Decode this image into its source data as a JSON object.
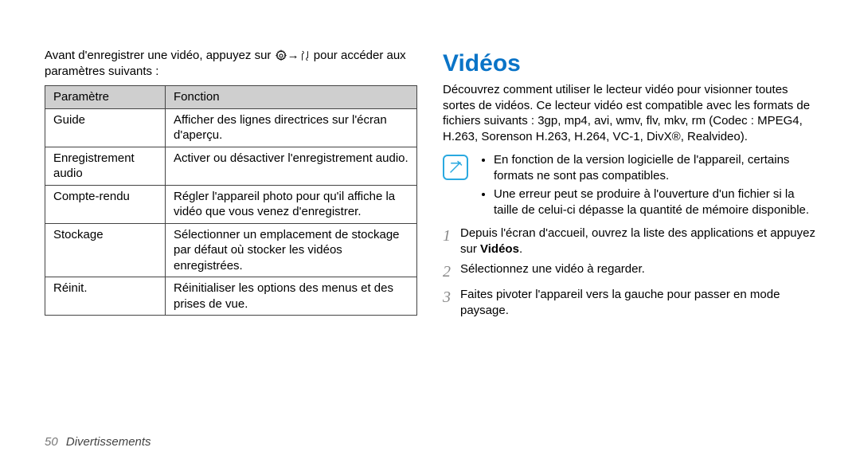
{
  "left": {
    "intro": "Avant d'enregistrer une vidéo, appuyez sur ",
    "intro_after_icons": " pour accéder aux paramètres suivants :",
    "table": {
      "head": {
        "param": "Paramètre",
        "func": "Fonction"
      },
      "rows": [
        {
          "param": "Guide",
          "func": "Afficher des lignes directrices sur l'écran d'aperçu."
        },
        {
          "param": "Enregistrement audio",
          "func": "Activer ou désactiver l'enregistrement audio."
        },
        {
          "param": "Compte-rendu",
          "func": "Régler l'appareil photo pour qu'il affiche la vidéo que vous venez d'enregistrer."
        },
        {
          "param": "Stockage",
          "func": "Sélectionner un emplacement de stockage par défaut où stocker les vidéos enregistrées."
        },
        {
          "param": "Réinit.",
          "func": "Réinitialiser les options des menus et des prises de vue."
        }
      ]
    }
  },
  "right": {
    "title": "Vidéos",
    "intro": "Découvrez comment utiliser le lecteur vidéo pour visionner toutes sortes de vidéos. Ce lecteur vidéo est compatible avec les formats de fichiers suivants : 3gp, mp4, avi, wmv, flv, mkv, rm (Codec : MPEG4, H.263, Sorenson H.263, H.264, VC-1, DivX®, Realvideo).",
    "notes": [
      "En fonction de la version logicielle de l'appareil, certains formats ne sont pas compatibles.",
      "Une erreur peut se produire à l'ouverture d'un fichier si la taille de celui-ci dépasse la quantité de mémoire disponible."
    ],
    "steps": [
      {
        "pre": "Depuis l'écran d'accueil, ouvrez la liste des applications et appuyez sur ",
        "bold": "Vidéos",
        "post": "."
      },
      {
        "text": "Sélectionnez une vidéo à regarder."
      },
      {
        "text": "Faites pivoter l'appareil vers la gauche pour passer en mode paysage."
      }
    ]
  },
  "footer": {
    "page": "50",
    "chapter": "Divertissements"
  }
}
